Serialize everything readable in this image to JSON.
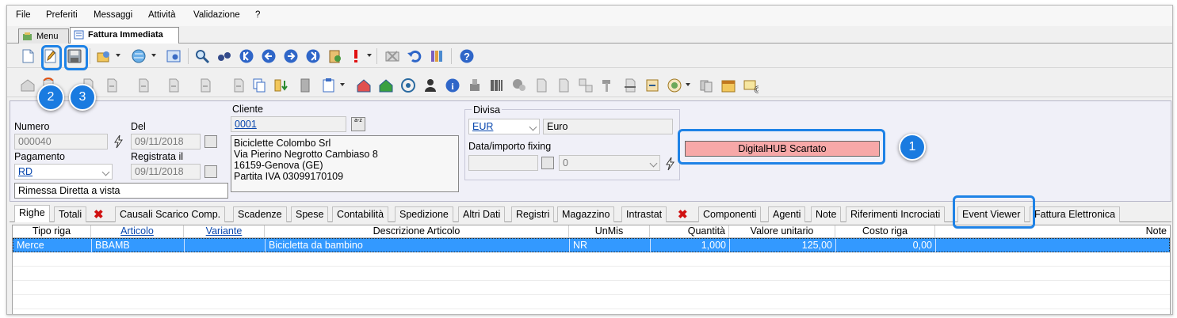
{
  "menu": [
    "File",
    "Preferiti",
    "Messaggi",
    "Attività",
    "Validazione",
    "?"
  ],
  "window_tabs": [
    {
      "label": "Menu",
      "active": false
    },
    {
      "label": "Fattura Immediata",
      "active": true
    }
  ],
  "badges": [
    "1",
    "2",
    "3"
  ],
  "form": {
    "numero_label": "Numero",
    "numero_value": "000040",
    "del_label": "Del",
    "del_value": "09/11/2018",
    "pagamento_label": "Pagamento",
    "pagamento_value": "RD",
    "registrata_label": "Registrata il",
    "registrata_value": "09/11/2018",
    "pagamento_desc": "Rimessa Diretta a vista",
    "cliente_label": "Cliente",
    "cliente_code": "0001",
    "cliente_address": [
      "Biciclette Colombo Srl",
      "Via Pierino Negrotto Cambiaso 8",
      "16159-Genova (GE)",
      "Partita IVA 03099170109"
    ],
    "divisa_label": "Divisa",
    "divisa_code": "EUR",
    "divisa_desc": "Euro",
    "fixing_label": "Data/importo fixing",
    "fixing_value": "0",
    "status_text": "DigitalHUB Scartato",
    "status_color": "#f7a8a8",
    "az_button": "a-z"
  },
  "inner_tabs": [
    "Righe",
    "Totali",
    "Causali Scarico Comp.",
    "Scadenze",
    "Spese",
    "Contabilità",
    "Spedizione",
    "Altri Dati",
    "Registri",
    "Magazzino",
    "Intrastat",
    "Componenti",
    "Agenti",
    "Note",
    "Riferimenti Incrociati",
    "Event Viewer",
    "Fattura Elettronica"
  ],
  "table": {
    "headers": [
      "Tipo riga",
      "Articolo",
      "Variante",
      "Descrizione Articolo",
      "UnMis",
      "Quantità",
      "Valore unitario",
      "Costo riga",
      "Note"
    ],
    "rows": [
      [
        "Merce",
        "BBAMB",
        "",
        "Bicicletta da bambino",
        "NR",
        "1,000",
        "125,00",
        "0,00",
        ""
      ]
    ]
  },
  "colors": {
    "accent": "#1e82e6",
    "selection": "#3399ff"
  }
}
